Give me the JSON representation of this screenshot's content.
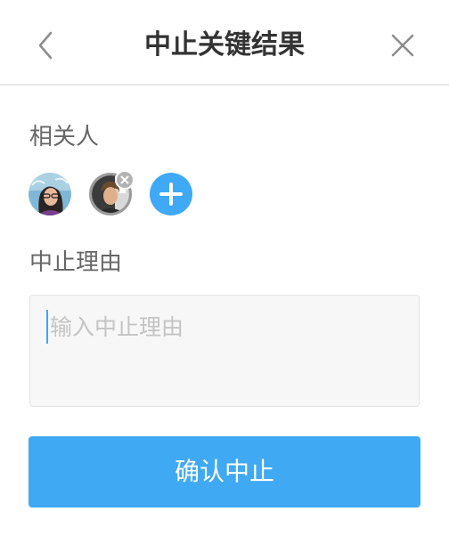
{
  "header": {
    "title": "中止关键结果",
    "back_icon": "chevron-left-icon",
    "close_icon": "close-icon"
  },
  "related": {
    "label": "相关人",
    "avatars": [
      {
        "icon": "user-avatar-icon",
        "removable": false
      },
      {
        "icon": "user-avatar-icon",
        "removable": true
      }
    ],
    "remove_icon": "remove-x-icon",
    "add_icon": "plus-icon"
  },
  "reason": {
    "label": "中止理由",
    "placeholder": "输入中止理由",
    "value": ""
  },
  "confirm": {
    "label": "确认中止"
  },
  "colors": {
    "accent": "#40a9f3",
    "title_text": "#333333",
    "label_text": "#666666",
    "placeholder_text": "#c4c4c4",
    "input_bg": "#f7f7f7",
    "divider": "#e6e6e6"
  }
}
